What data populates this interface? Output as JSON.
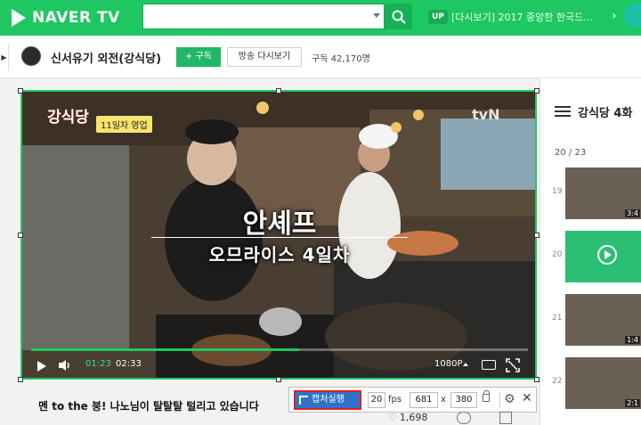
{
  "topbar": {
    "logo_text": "NAVER TV",
    "search_value": "",
    "up_badge": "UP",
    "recommend_text": "[다시보기] 2017 중앙한 한국드...",
    "colors": {
      "brand": "#1ec760",
      "search_button": "#16b157"
    }
  },
  "channel": {
    "title": "신서유기 외전(강식당)",
    "subscribe_label": "+ 구독",
    "replay_label": "방송 다시보기",
    "subscriber_count": "구독 42,170명"
  },
  "video": {
    "overlay_show_title": "강식당",
    "overlay_day_badge": "11일차 영업",
    "broadcaster_mark": "tvN",
    "subtitle_main": "안셰프",
    "subtitle_sub": "오므라이스 4일차",
    "current_time": "01:23",
    "duration": "02:33",
    "progress_fraction": 0.54,
    "quality_label": "1080P"
  },
  "clip": {
    "title": "멘 to the 붕! 나노님이 탈탈탈 털리고 있습니다",
    "likes": "1,698"
  },
  "capture_toolbar": {
    "capture_label": "캡처실행",
    "fps_value": "20",
    "fps_label": "fps",
    "width_value": "681",
    "x_label": "x",
    "height_value": "380",
    "highlight_color": "#e21f1f",
    "button_color": "#2f73c9"
  },
  "sidebar": {
    "heading": "강식당 4화",
    "count": "20 / 23",
    "items": [
      {
        "number": "19",
        "duration": "3:4"
      },
      {
        "number": "20",
        "duration": "",
        "active": true
      },
      {
        "number": "21",
        "duration": "1:4"
      },
      {
        "number": "22",
        "duration": "2:1"
      }
    ]
  }
}
